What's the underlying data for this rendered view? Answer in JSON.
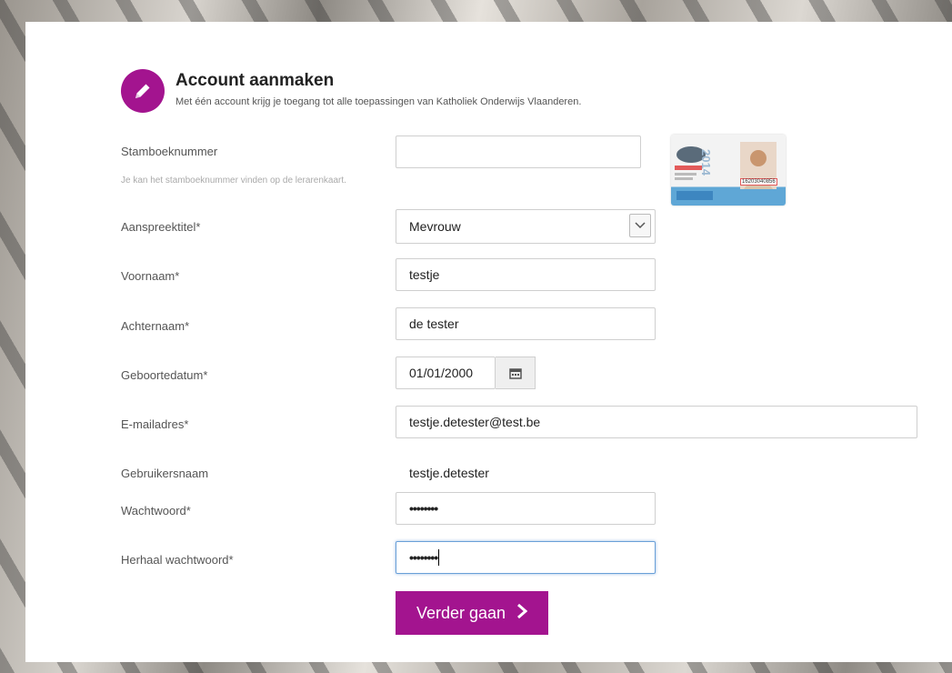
{
  "header": {
    "title": "Account aanmaken",
    "subtitle": "Met één account krijg je toegang tot alle toepassingen van Katholiek Onderwijs Vlaanderen."
  },
  "form": {
    "stamboeknummer": {
      "label": "Stamboeknummer",
      "value": "",
      "hint": "Je kan het stamboeknummer vinden op de lerarenkaart."
    },
    "aanspreektitel": {
      "label": "Aanspreektitel*",
      "value": "Mevrouw"
    },
    "voornaam": {
      "label": "Voornaam*",
      "value": "testje"
    },
    "achternaam": {
      "label": "Achternaam*",
      "value": "de tester"
    },
    "geboortedatum": {
      "label": "Geboortedatum*",
      "value": "01/01/2000"
    },
    "email": {
      "label": "E-mailadres*",
      "value": "testje.detester@test.be"
    },
    "gebruikersnaam": {
      "label": "Gebruikersnaam",
      "value": "testje.detester"
    },
    "wachtwoord": {
      "label": "Wachtwoord*",
      "value": "••••••••"
    },
    "herhaal": {
      "label": "Herhaal wachtwoord*",
      "value": "••••••••"
    }
  },
  "card_image": {
    "year": "2014",
    "number": "16203040856"
  },
  "submit": {
    "label": "Verder gaan"
  },
  "colors": {
    "brand": "#a3148f",
    "focus": "#6aa0d8"
  },
  "icons": {
    "header": "pencil-icon",
    "select": "chevron-down-icon",
    "date": "calendar-icon",
    "submit": "chevron-right-icon"
  }
}
